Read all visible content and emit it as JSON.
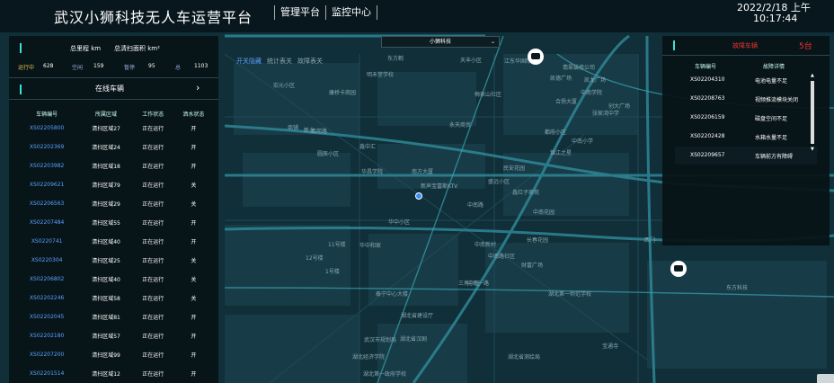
{
  "header": {
    "title": "武汉小狮科技无人车运营平台",
    "nav": [
      "管理平台",
      "监控中心"
    ],
    "date": "2022/2/18 上午",
    "time": "10:17:44"
  },
  "summary": {
    "total_mileage_label": "总里程 km",
    "total_area_label": "总清扫面积 km²",
    "running_label": "运行中",
    "running_value": "628",
    "idle_label": "空闲",
    "idle_value": "159",
    "paused_label": "暂停",
    "paused_value": "95",
    "total_label": "总",
    "total_value": "1103"
  },
  "online": {
    "title": "在线车辆",
    "columns": [
      "车辆编号",
      "所属区域",
      "工作状态",
      "洒水状态"
    ],
    "rows": [
      [
        "XS02205800",
        "清扫区域27",
        "正在运行",
        "开"
      ],
      [
        "XS02202369",
        "清扫区域24",
        "正在运行",
        "开"
      ],
      [
        "XS02203982",
        "清扫区域18",
        "正在运行",
        "开"
      ],
      [
        "XS02209621",
        "清扫区域79",
        "正在运行",
        "关"
      ],
      [
        "XS02206563",
        "清扫区域29",
        "正在运行",
        "关"
      ],
      [
        "XS02207484",
        "清扫区域55",
        "正在运行",
        "开"
      ],
      [
        "XS0220741",
        "清扫区域40",
        "正在运行",
        "开"
      ],
      [
        "XS0220304",
        "清扫区域25",
        "正在运行",
        "关"
      ],
      [
        "XS02206802",
        "清扫区域40",
        "正在运行",
        "关"
      ],
      [
        "XS02202246",
        "清扫区域58",
        "正在运行",
        "关"
      ],
      [
        "XS02202045",
        "清扫区域81",
        "正在运行",
        "开"
      ],
      [
        "XS02202180",
        "清扫区域57",
        "正在运行",
        "开"
      ],
      [
        "XS02207200",
        "清扫区域99",
        "正在运行",
        "开"
      ],
      [
        "XS02201514",
        "清扫区域12",
        "正在运行",
        "开"
      ]
    ]
  },
  "map": {
    "dropdown_value": "小狮科技",
    "tabs": [
      "开关隐藏",
      "统计表关",
      "故障表关"
    ],
    "labels": [
      "东方鹤",
      "天丰小区",
      "江东华国际",
      "明禾堂学校",
      "梅家山社区",
      "康桥卡商园",
      "中南小学",
      "新龙",
      "鑫中汇",
      "民安花园",
      "盛远小区",
      "鑫红子商苑",
      "华昌学院",
      "中南花园",
      "长春花园",
      "凯龙广场",
      "翡翠装修公司",
      "中南学院",
      "张家湾中学",
      "创大广场",
      "都府小区",
      "永天商贸",
      "圆辰小区",
      "西苑路",
      "中南一路",
      "新声宝富斯KTV",
      "中南路",
      "锦江之星",
      "财富广场",
      "合扬大厦",
      "宏元小区",
      "商铺",
      "南方大厦",
      "华中小区",
      "中南新村",
      "11号楼",
      "华中和家",
      "12号楼",
      "1号楼",
      "中南路社区",
      "凯德广场",
      "三角小区",
      "泰宁中心大楼",
      "湖北省建设厅",
      "武汉市规划局",
      "湖北省汉剧",
      "湖北经济学院",
      "湖北第一政府学校",
      "东方科技",
      "湖北第一师范学校",
      "宝通寺",
      "湖北省测绘局",
      "西门"
    ]
  },
  "faults": {
    "title": "故障车辆",
    "count": "5台",
    "columns": [
      "车辆编号",
      "故障详情"
    ],
    "rows": [
      [
        "XS02204310",
        "电池电量不足"
      ],
      [
        "XS02208763",
        "视频推流模块关闭"
      ],
      [
        "XS02206159",
        "磁盘空间不足"
      ],
      [
        "XS02202428",
        "水箱水量不足"
      ],
      [
        "XS02209657",
        "车辆前方有障碍"
      ]
    ]
  },
  "colors": {
    "accent": "#3de0d4",
    "link": "#5aa3ff",
    "alert": "#e33333",
    "running": "#e4c34c"
  },
  "icons": [
    "car-marker-icon",
    "location-dot-icon",
    "chevron-right-icon",
    "chevron-down-icon"
  ]
}
